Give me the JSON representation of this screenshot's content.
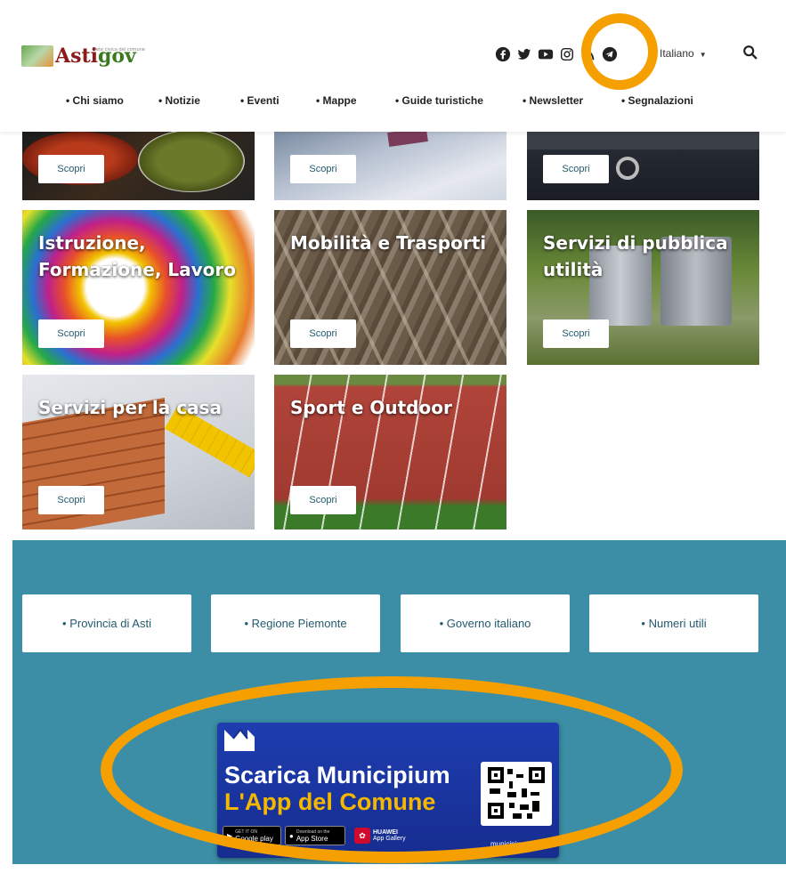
{
  "header": {
    "logo_text_main": "Asti",
    "logo_text_accent": "gov",
    "logo_small_text": "rete civica del comune",
    "language": "Italiano",
    "socials": [
      "facebook-icon",
      "twitter-icon",
      "youtube-icon",
      "instagram-icon",
      "rss-icon",
      "telegram-icon"
    ]
  },
  "nav": {
    "items": [
      "• Chi siamo",
      "• Notizie",
      "• Eventi",
      "• Mappe",
      "• Guide turistiche",
      "• Newsletter",
      "• Segnalazioni"
    ]
  },
  "cards": {
    "discover_label": "Scopri",
    "items": [
      {
        "title": ""
      },
      {
        "title": ""
      },
      {
        "title": ""
      },
      {
        "title": "Istruzione, Formazione, Lavoro"
      },
      {
        "title": "Mobilità e Trasporti"
      },
      {
        "title": "Servizi di pubblica utilità"
      },
      {
        "title": "Servizi per la casa"
      },
      {
        "title": "Sport e Outdoor"
      }
    ]
  },
  "footer": {
    "links": [
      "• Provincia di Asti",
      "• Regione Piemonte",
      "• Governo italiano",
      "• Numeri utili"
    ],
    "app": {
      "line1": "Scarica Municipium",
      "line2": "L'App del Comune",
      "url": "municipiumapp.it",
      "google": "Google play",
      "apple": "App Store",
      "huawei": "HUAWEI",
      "huawei_sub": "App Gallery",
      "google_small": "GET IT ON",
      "apple_small": "Download on the"
    }
  },
  "colors": {
    "footer_bg": "#3b8ea5",
    "highlight": "#f5a000",
    "button_text": "#235a6e"
  }
}
